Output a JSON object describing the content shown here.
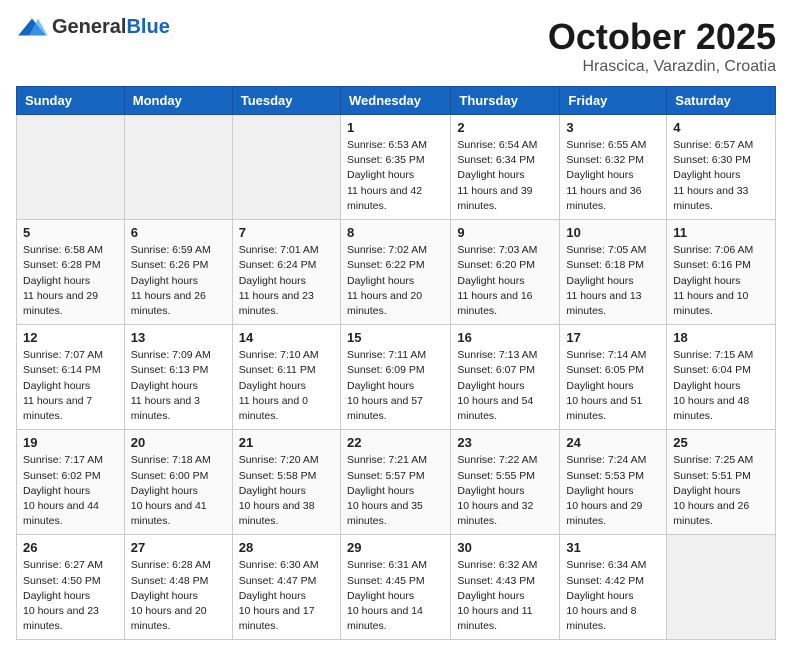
{
  "header": {
    "logo_general": "General",
    "logo_blue": "Blue",
    "month_title": "October 2025",
    "location": "Hrascica, Varazdin, Croatia"
  },
  "weekdays": [
    "Sunday",
    "Monday",
    "Tuesday",
    "Wednesday",
    "Thursday",
    "Friday",
    "Saturday"
  ],
  "weeks": [
    [
      {
        "day": "",
        "empty": true
      },
      {
        "day": "",
        "empty": true
      },
      {
        "day": "",
        "empty": true
      },
      {
        "day": "1",
        "sunrise": "6:53 AM",
        "sunset": "6:35 PM",
        "daylight": "11 hours and 42 minutes."
      },
      {
        "day": "2",
        "sunrise": "6:54 AM",
        "sunset": "6:34 PM",
        "daylight": "11 hours and 39 minutes."
      },
      {
        "day": "3",
        "sunrise": "6:55 AM",
        "sunset": "6:32 PM",
        "daylight": "11 hours and 36 minutes."
      },
      {
        "day": "4",
        "sunrise": "6:57 AM",
        "sunset": "6:30 PM",
        "daylight": "11 hours and 33 minutes."
      }
    ],
    [
      {
        "day": "5",
        "sunrise": "6:58 AM",
        "sunset": "6:28 PM",
        "daylight": "11 hours and 29 minutes."
      },
      {
        "day": "6",
        "sunrise": "6:59 AM",
        "sunset": "6:26 PM",
        "daylight": "11 hours and 26 minutes."
      },
      {
        "day": "7",
        "sunrise": "7:01 AM",
        "sunset": "6:24 PM",
        "daylight": "11 hours and 23 minutes."
      },
      {
        "day": "8",
        "sunrise": "7:02 AM",
        "sunset": "6:22 PM",
        "daylight": "11 hours and 20 minutes."
      },
      {
        "day": "9",
        "sunrise": "7:03 AM",
        "sunset": "6:20 PM",
        "daylight": "11 hours and 16 minutes."
      },
      {
        "day": "10",
        "sunrise": "7:05 AM",
        "sunset": "6:18 PM",
        "daylight": "11 hours and 13 minutes."
      },
      {
        "day": "11",
        "sunrise": "7:06 AM",
        "sunset": "6:16 PM",
        "daylight": "11 hours and 10 minutes."
      }
    ],
    [
      {
        "day": "12",
        "sunrise": "7:07 AM",
        "sunset": "6:14 PM",
        "daylight": "11 hours and 7 minutes."
      },
      {
        "day": "13",
        "sunrise": "7:09 AM",
        "sunset": "6:13 PM",
        "daylight": "11 hours and 3 minutes."
      },
      {
        "day": "14",
        "sunrise": "7:10 AM",
        "sunset": "6:11 PM",
        "daylight": "11 hours and 0 minutes."
      },
      {
        "day": "15",
        "sunrise": "7:11 AM",
        "sunset": "6:09 PM",
        "daylight": "10 hours and 57 minutes."
      },
      {
        "day": "16",
        "sunrise": "7:13 AM",
        "sunset": "6:07 PM",
        "daylight": "10 hours and 54 minutes."
      },
      {
        "day": "17",
        "sunrise": "7:14 AM",
        "sunset": "6:05 PM",
        "daylight": "10 hours and 51 minutes."
      },
      {
        "day": "18",
        "sunrise": "7:15 AM",
        "sunset": "6:04 PM",
        "daylight": "10 hours and 48 minutes."
      }
    ],
    [
      {
        "day": "19",
        "sunrise": "7:17 AM",
        "sunset": "6:02 PM",
        "daylight": "10 hours and 44 minutes."
      },
      {
        "day": "20",
        "sunrise": "7:18 AM",
        "sunset": "6:00 PM",
        "daylight": "10 hours and 41 minutes."
      },
      {
        "day": "21",
        "sunrise": "7:20 AM",
        "sunset": "5:58 PM",
        "daylight": "10 hours and 38 minutes."
      },
      {
        "day": "22",
        "sunrise": "7:21 AM",
        "sunset": "5:57 PM",
        "daylight": "10 hours and 35 minutes."
      },
      {
        "day": "23",
        "sunrise": "7:22 AM",
        "sunset": "5:55 PM",
        "daylight": "10 hours and 32 minutes."
      },
      {
        "day": "24",
        "sunrise": "7:24 AM",
        "sunset": "5:53 PM",
        "daylight": "10 hours and 29 minutes."
      },
      {
        "day": "25",
        "sunrise": "7:25 AM",
        "sunset": "5:51 PM",
        "daylight": "10 hours and 26 minutes."
      }
    ],
    [
      {
        "day": "26",
        "sunrise": "6:27 AM",
        "sunset": "4:50 PM",
        "daylight": "10 hours and 23 minutes."
      },
      {
        "day": "27",
        "sunrise": "6:28 AM",
        "sunset": "4:48 PM",
        "daylight": "10 hours and 20 minutes."
      },
      {
        "day": "28",
        "sunrise": "6:30 AM",
        "sunset": "4:47 PM",
        "daylight": "10 hours and 17 minutes."
      },
      {
        "day": "29",
        "sunrise": "6:31 AM",
        "sunset": "4:45 PM",
        "daylight": "10 hours and 14 minutes."
      },
      {
        "day": "30",
        "sunrise": "6:32 AM",
        "sunset": "4:43 PM",
        "daylight": "10 hours and 11 minutes."
      },
      {
        "day": "31",
        "sunrise": "6:34 AM",
        "sunset": "4:42 PM",
        "daylight": "10 hours and 8 minutes."
      },
      {
        "day": "",
        "empty": true
      }
    ]
  ]
}
